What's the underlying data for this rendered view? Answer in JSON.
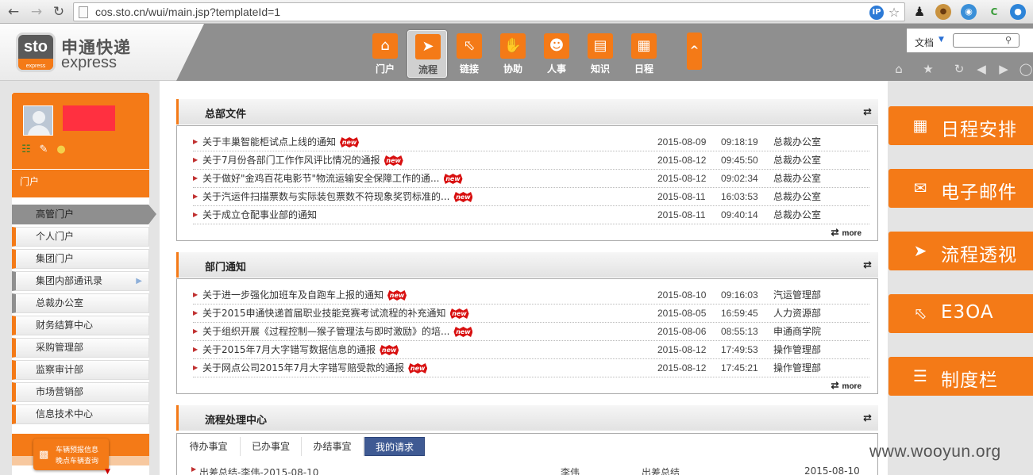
{
  "browser": {
    "url": "cos.sto.cn/wui/main.jsp?templateId=1",
    "back_icon": "arrow-left-icon",
    "forward_icon": "arrow-right-icon",
    "reload_icon": "reload-icon",
    "badge_text": "IP",
    "ext_c_text": "C"
  },
  "header": {
    "logo_mark": "sto",
    "logo_mark_sub": "express",
    "logo_cn": "申通快递",
    "logo_en": "express",
    "nav": [
      {
        "label": "门户",
        "icon": "home-icon"
      },
      {
        "label": "流程",
        "icon": "signpost-icon"
      },
      {
        "label": "链接",
        "icon": "cursor-icon"
      },
      {
        "label": "协助",
        "icon": "hand-icon"
      },
      {
        "label": "人事",
        "icon": "people-icon"
      },
      {
        "label": "知识",
        "icon": "book-icon"
      },
      {
        "label": "日程",
        "icon": "calendar-icon"
      }
    ],
    "active_nav": "流程",
    "search_label": "文档",
    "search_value": ""
  },
  "user": {
    "name": ""
  },
  "sidebar": {
    "portal_header": "门户",
    "items": [
      {
        "label": "高管门户",
        "active": true
      },
      {
        "label": "个人门户"
      },
      {
        "label": "集团门户"
      },
      {
        "label": "集团内部通讯录",
        "has_submenu": true
      },
      {
        "label": "总裁办公室"
      },
      {
        "label": "财务结算中心"
      },
      {
        "label": "采购管理部"
      },
      {
        "label": "监察审计部"
      },
      {
        "label": "市场营销部"
      },
      {
        "label": "信息技术中心"
      }
    ],
    "car_button": {
      "line1": "车辆预报信息",
      "line2": "晚点车辆查询"
    }
  },
  "sections": {
    "hq_files": {
      "title": "总部文件",
      "more": "more",
      "rows": [
        {
          "title": "关于丰巢智能柜试点上线的通知",
          "new": true,
          "date": "2015-08-09",
          "time": "09:18:19",
          "dept": "总裁办公室"
        },
        {
          "title": "关于7月份各部门工作作风评比情况的通报",
          "new": true,
          "date": "2015-08-12",
          "time": "09:45:50",
          "dept": "总裁办公室"
        },
        {
          "title": "关于做好\"金鸡百花电影节\"物流运输安全保障工作的通...",
          "new": true,
          "date": "2015-08-12",
          "time": "09:02:34",
          "dept": "总裁办公室"
        },
        {
          "title": "关于汽运件扫描票数与实际装包票数不符现象奖罚标准的...",
          "new": true,
          "date": "2015-08-11",
          "time": "16:03:53",
          "dept": "总裁办公室"
        },
        {
          "title": "关于成立仓配事业部的通知",
          "new": false,
          "date": "2015-08-11",
          "time": "09:40:14",
          "dept": "总裁办公室"
        }
      ]
    },
    "dept_notice": {
      "title": "部门通知",
      "more": "more",
      "rows": [
        {
          "title": "关于进一步强化加班车及自跑车上报的通知",
          "new": true,
          "date": "2015-08-10",
          "time": "09:16:03",
          "dept": "汽运管理部"
        },
        {
          "title": "关于2015申通快递首届职业技能竞赛考试流程的补充通知",
          "new": true,
          "date": "2015-08-05",
          "time": "16:59:45",
          "dept": "人力资源部"
        },
        {
          "title": "关于组织开展《过程控制—猴子管理法与即时激励》的培...",
          "new": true,
          "date": "2015-08-06",
          "time": "08:55:13",
          "dept": "申通商学院"
        },
        {
          "title": "关于2015年7月大字错写数据信息的通报",
          "new": true,
          "date": "2015-08-12",
          "time": "17:49:53",
          "dept": "操作管理部"
        },
        {
          "title": "关于网点公司2015年7月大字错写赔受款的通报",
          "new": true,
          "date": "2015-08-12",
          "time": "17:45:21",
          "dept": "操作管理部"
        }
      ]
    },
    "workflow": {
      "title": "流程处理中心",
      "tabs": [
        "待办事宜",
        "已办事宜",
        "办结事宜",
        "我的请求"
      ],
      "selected_tab": "我的请求",
      "row": {
        "title": "出差总结-李伟-2015-08-10",
        "creator": "李伟",
        "type": "出差总结",
        "date": "2015-08-10"
      }
    }
  },
  "right_tiles": [
    {
      "label": "日程安排",
      "icon": "calendar-icon"
    },
    {
      "label": "电子邮件",
      "icon": "envelope-icon"
    },
    {
      "label": "流程透视",
      "icon": "signpost-icon"
    },
    {
      "label": "E3OA",
      "icon": "cursor-icon"
    },
    {
      "label": "制度栏",
      "icon": "list-icon"
    }
  ],
  "new_badge": "new",
  "watermark": "www.wooyun.org",
  "colors": {
    "accent": "#f47a17",
    "band": "#8f8f8f",
    "tab_selected": "#3f5a93",
    "new_badge": "#d81010"
  }
}
